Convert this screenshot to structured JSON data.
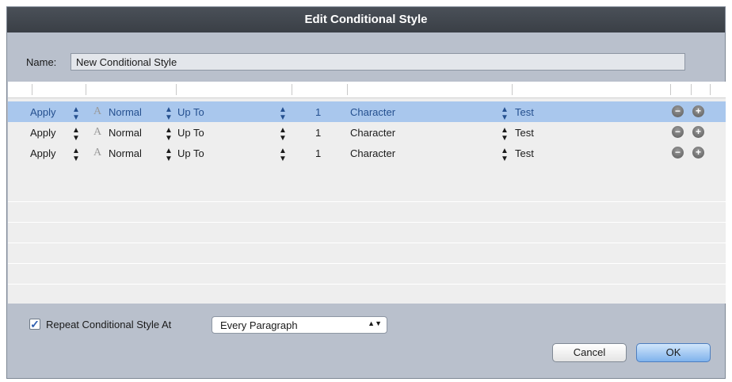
{
  "dialog": {
    "title": "Edit Conditional Style"
  },
  "name": {
    "label": "Name:",
    "value": "New Conditional Style"
  },
  "rows": [
    {
      "apply": "Apply",
      "style": "Normal",
      "mode": "Up To",
      "count": "1",
      "unit": "Character",
      "target": "Test",
      "selected": true
    },
    {
      "apply": "Apply",
      "style": "Normal",
      "mode": "Up To",
      "count": "1",
      "unit": "Character",
      "target": "Test",
      "selected": false
    },
    {
      "apply": "Apply",
      "style": "Normal",
      "mode": "Up To",
      "count": "1",
      "unit": "Character",
      "target": "Test",
      "selected": false
    }
  ],
  "row_icons": {
    "style_icon": "character-style-icon",
    "remove": "minus-icon",
    "add": "plus-icon"
  },
  "repeat": {
    "checked": true,
    "label": "Repeat Conditional Style At",
    "value": "Every Paragraph"
  },
  "buttons": {
    "cancel": "Cancel",
    "ok": "OK"
  },
  "colors": {
    "selection": "#a9c7ed",
    "title_bar": "#3f444b",
    "ok_button": "#7fb2ec"
  }
}
